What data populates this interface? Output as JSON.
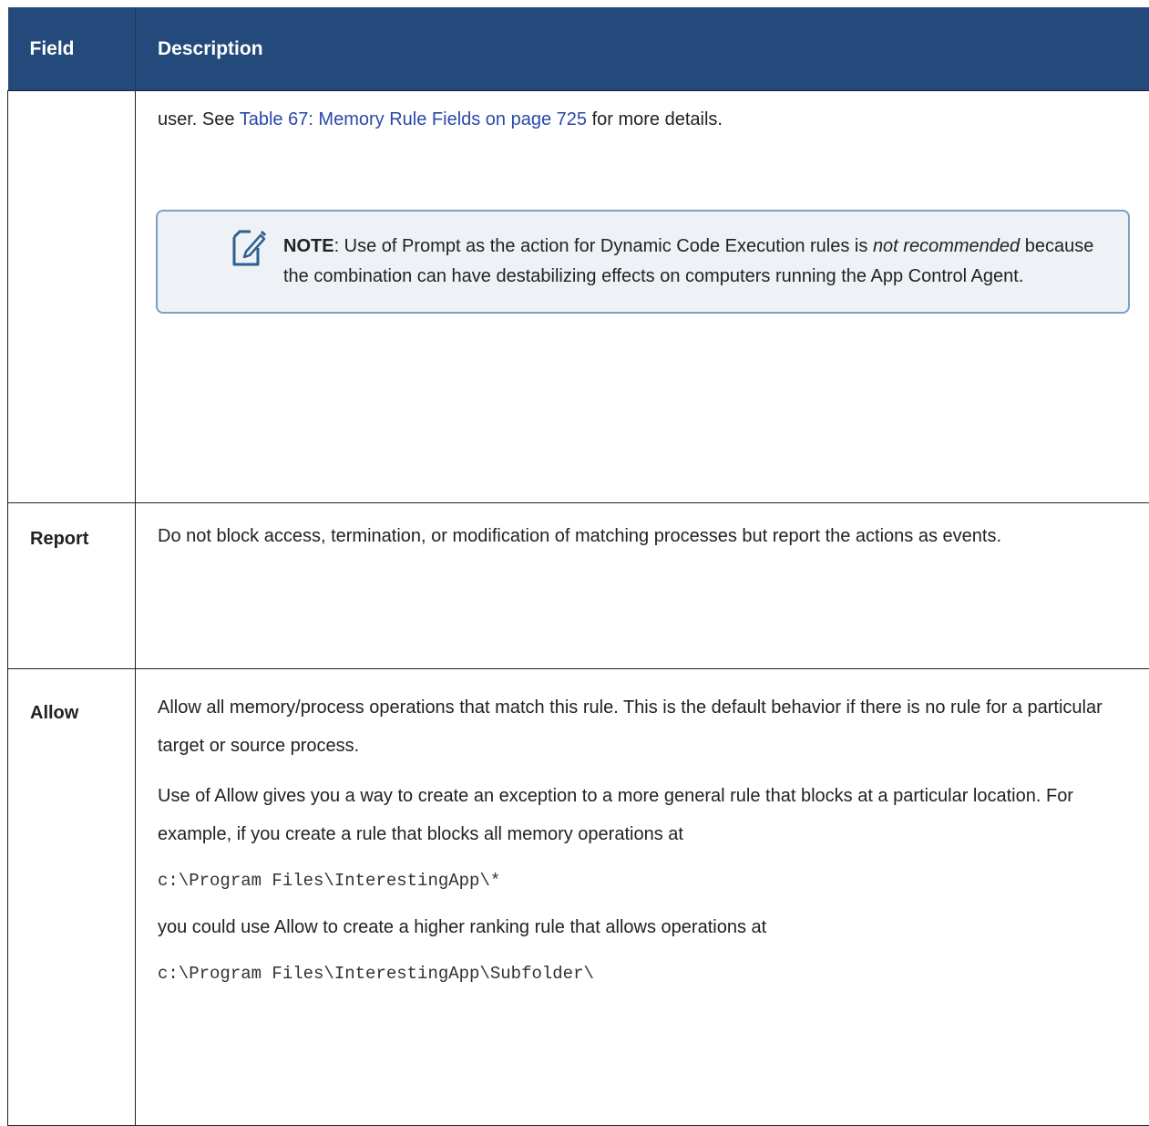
{
  "table": {
    "header": {
      "field": "Field",
      "description": "Description"
    },
    "row1": {
      "field": "",
      "text_before_link": "user. See ",
      "link": "Table 67: Memory Rule Fields on page 725",
      "text_after_link": " for more details.",
      "note": {
        "label": "NOTE",
        "text1": ": Use of Prompt as the action for Dynamic Code Execution rules is ",
        "emphasis": "not recommended",
        "text2": " because the combination can have destabilizing effects on computers running the App Control Agent."
      }
    },
    "row2": {
      "field": "Report",
      "description": "Do not block access, termination, or modification of matching processes but report the actions as events."
    },
    "row3": {
      "field": "Allow",
      "para1": "Allow all memory/process operations that match this rule. This is the default behavior if there is no rule for a particular target or source process.",
      "para2": "Use of Allow gives you a way to create an exception to a more general rule that blocks at a particular location. For example, if you create a rule that blocks all memory operations at",
      "code1": "c:\\Program Files\\InterestingApp\\*",
      "para3": "you could use Allow to create a higher ranking rule that allows operations at",
      "code2": "c:\\Program Files\\InterestingApp\\Subfolder\\"
    }
  },
  "colors": {
    "header_bg": "#244a7c",
    "link": "#2a49a8",
    "note_border": "#7aa0c4",
    "note_bg": "#eef2f6"
  },
  "icons": {
    "note": "note-pencil-icon"
  }
}
